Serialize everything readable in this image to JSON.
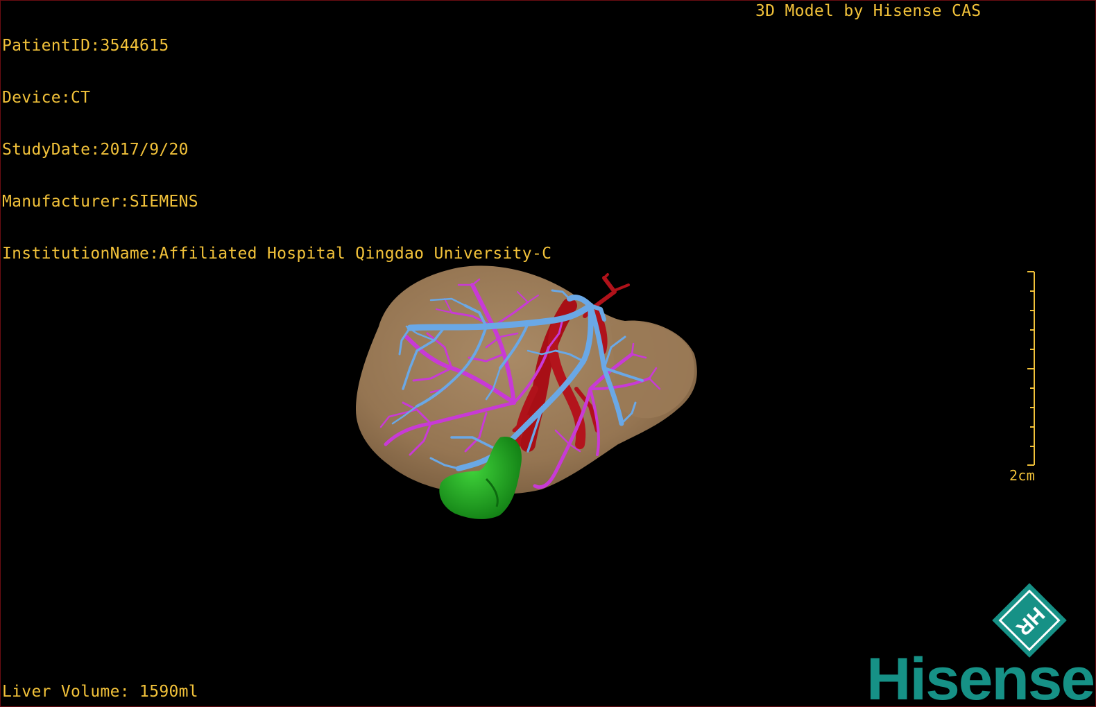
{
  "overlay": {
    "patient_id": "PatientID:3544615",
    "device": "Device:CT",
    "study_date": "StudyDate:2017/9/20",
    "manufacturer": "Manufacturer:SIEMENS",
    "institution": "InstitutionName:Affiliated Hospital Qingdao University-C",
    "brand": "3D Model by Hisense CAS",
    "liver_volume": "Liver Volume: 1590ml"
  },
  "scale": {
    "label": "2cm"
  },
  "logo": {
    "word": "Hisense",
    "badge": "HR"
  },
  "colors": {
    "overlay_text": "#f2c23a",
    "liver": "#9c7b58",
    "portal_vein": "#6aa8e6",
    "hepatic_vein": "#c83ad6",
    "artery": "#b0121a",
    "gallbladder": "#1fa51f",
    "logo": "#169186",
    "background": "#000000"
  },
  "icons": {
    "logo_badge": "hr-diamond-icon"
  }
}
